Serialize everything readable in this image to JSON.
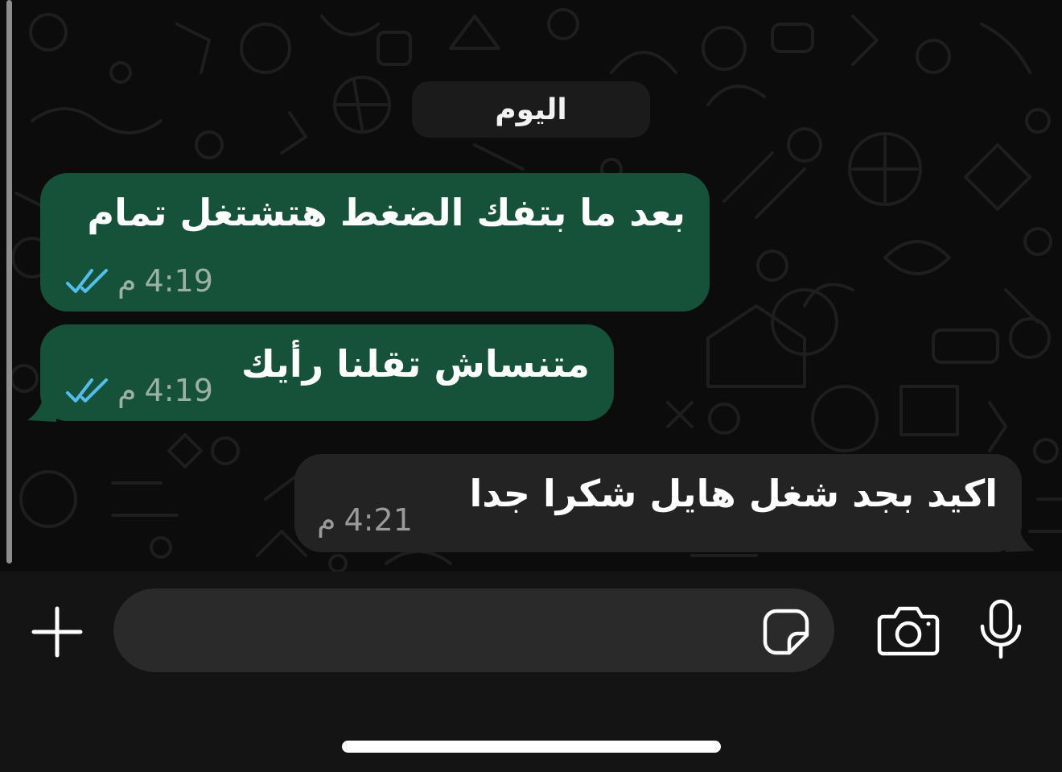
{
  "date_separator": "اليوم",
  "messages": [
    {
      "direction": "outgoing",
      "text": "بعد ما بتفك الضغط هتشتغل تمام",
      "time": "4:19",
      "period": "م",
      "status": "read"
    },
    {
      "direction": "outgoing",
      "text": "متنساش تقلنا رأيك",
      "time": "4:19",
      "period": "م",
      "status": "read"
    },
    {
      "direction": "incoming",
      "text": "اكيد بجد شغل هايل شكرا جدا",
      "time": "4:21",
      "period": "م"
    }
  ],
  "composer": {
    "placeholder": "",
    "value": ""
  },
  "icons": {
    "add": "plus-icon",
    "sticker": "sticker-icon",
    "camera": "camera-icon",
    "microphone": "microphone-icon",
    "read_receipt": "double-check-icon"
  },
  "colors": {
    "outgoing_bubble": "#16513a",
    "incoming_bubble": "#232323",
    "read_tick": "#53bdeb",
    "background": "#0c0c0c"
  }
}
